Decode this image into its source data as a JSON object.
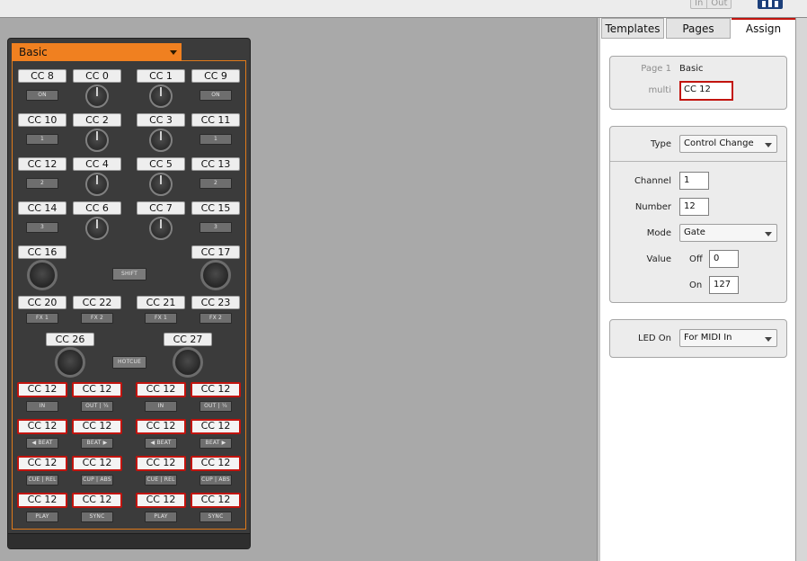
{
  "topbar": {
    "in_label": "In",
    "out_label": "Out",
    "logo_name": "native-instruments-logo"
  },
  "template": {
    "name": "Basic"
  },
  "controller": {
    "row1": {
      "cc": [
        "CC 8",
        "CC 0",
        "CC 1",
        "CC 9"
      ],
      "btn_left": "ON",
      "btn_right": "ON"
    },
    "row2": {
      "cc": [
        "CC 10",
        "CC 2",
        "CC 3",
        "CC 11"
      ],
      "btn_left": "1",
      "btn_right": "1"
    },
    "row3": {
      "cc": [
        "CC 12",
        "CC 4",
        "CC 5",
        "CC 13"
      ],
      "btn_left": "2",
      "btn_right": "2"
    },
    "row4": {
      "cc": [
        "CC 14",
        "CC 6",
        "CC 7",
        "CC 15"
      ],
      "btn_left": "3",
      "btn_right": "3"
    },
    "row5": {
      "cc": [
        "CC 16",
        "CC 17"
      ],
      "shift": "SHIFT"
    },
    "row6": {
      "cc": [
        "CC 20",
        "CC 22",
        "CC 21",
        "CC 23"
      ],
      "btns": [
        "FX 1",
        "FX 2",
        "FX 1",
        "FX 2"
      ]
    },
    "row7": {
      "cc": [
        "CC 26",
        "CC 27"
      ],
      "hotcue": "HOTCUE"
    },
    "row8": {
      "cc": [
        "CC 12",
        "CC 12",
        "CC 12",
        "CC 12"
      ],
      "btns": [
        "IN",
        "OUT | ¼",
        "IN",
        "OUT | ¼"
      ]
    },
    "row9": {
      "cc": [
        "CC 12",
        "CC 12",
        "CC 12",
        "CC 12"
      ],
      "btns": [
        "◀ BEAT",
        "BEAT ▶",
        "◀ BEAT",
        "BEAT ▶"
      ]
    },
    "row10": {
      "cc": [
        "CC 12",
        "CC 12",
        "CC 12",
        "CC 12"
      ],
      "btns": [
        "CUE | REL",
        "CUP | ABS",
        "CUE | REL",
        "CUP | ABS"
      ]
    },
    "row11": {
      "cc": [
        "CC 12",
        "CC 12",
        "CC 12",
        "CC 12"
      ],
      "btns": [
        "PLAY",
        "SYNC",
        "PLAY",
        "SYNC"
      ]
    }
  },
  "tabs": [
    "Templates",
    "Pages",
    "Assign"
  ],
  "assign": {
    "page_label": "Page 1",
    "page_value": "Basic",
    "multi_label": "multi",
    "multi_value": "CC 12",
    "type_label": "Type",
    "type_value": "Control Change",
    "channel_label": "Channel",
    "channel_value": "1",
    "number_label": "Number",
    "number_value": "12",
    "mode_label": "Mode",
    "mode_value": "Gate",
    "value_label": "Value",
    "off_label": "Off",
    "off_value": "0",
    "on_label": "On",
    "on_value": "127",
    "led_label": "LED On",
    "led_value": "For MIDI In"
  },
  "colors": {
    "accent_orange": "#f08020",
    "selection_red": "#c2140e",
    "panel_bg": "#3b3b3b",
    "workspace_bg": "#a9a9a9"
  }
}
